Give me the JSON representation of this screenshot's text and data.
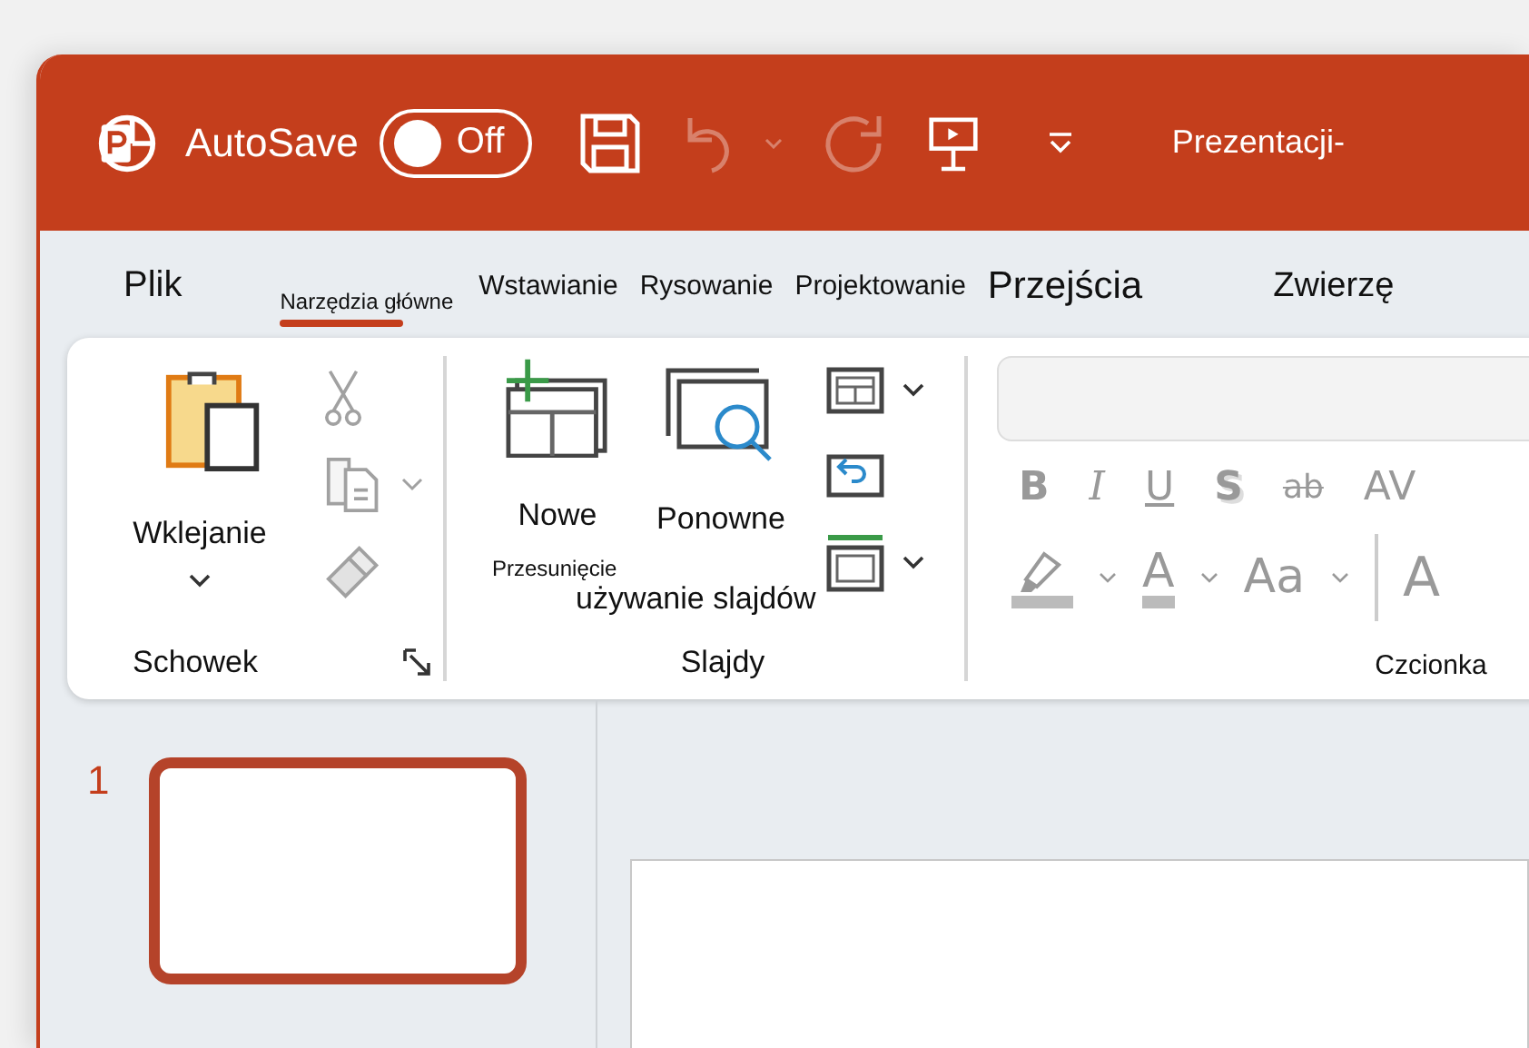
{
  "title_bar": {
    "autosave_label": "AutoSave",
    "autosave_on": false,
    "autosave_state": "Off",
    "title": "Prezentacji-"
  },
  "quick_access": [
    {
      "kind": "save",
      "disabled": false
    },
    {
      "kind": "undo",
      "disabled": true
    },
    {
      "kind": "redo",
      "disabled": true
    },
    {
      "kind": "present",
      "disabled": false
    },
    {
      "kind": "customize",
      "disabled": false
    }
  ],
  "tabs": [
    {
      "label": "Plik",
      "selected": false
    },
    {
      "label": "Narzędzia główne",
      "selected": true
    },
    {
      "label": "Wstawianie",
      "selected": false
    },
    {
      "label": "Rysowanie",
      "selected": false
    },
    {
      "label": "Projektowanie",
      "selected": false
    },
    {
      "label": "Przejścia",
      "selected": false
    },
    {
      "label": "Zwierzę",
      "selected": false
    }
  ],
  "ribbon": {
    "clipboard": {
      "label": "Schowek",
      "paste_label": "Wklejanie",
      "tools": [
        {
          "kind": "cut",
          "disabled": true
        },
        {
          "kind": "copy",
          "disabled": true
        },
        {
          "kind": "painter",
          "disabled": true
        }
      ]
    },
    "slides": {
      "label": "Slajdy",
      "new_label": "Nowe",
      "reuse_label_1": "Ponowne",
      "reuse_label_2": "używanie slajdów",
      "move_label": "Przesunięcie"
    },
    "font": {
      "label": "Czcionka",
      "styles": [
        {
          "text": "B",
          "kind": "bold",
          "disabled": true
        },
        {
          "text": "I",
          "kind": "italic",
          "disabled": true
        },
        {
          "text": "U",
          "kind": "underline",
          "disabled": true
        },
        {
          "text": "S",
          "kind": "shadow",
          "disabled": true
        },
        {
          "text": "ab",
          "kind": "strike",
          "disabled": true
        },
        {
          "text": "AV",
          "kind": "spacing",
          "disabled": true
        }
      ],
      "row2": [
        {
          "text": "A",
          "kind": "color",
          "disabled": true
        },
        {
          "text": "Aa",
          "kind": "case",
          "disabled": true
        },
        {
          "text": "A",
          "kind": "grow",
          "disabled": true
        }
      ]
    }
  },
  "slides": [
    {
      "number": "1",
      "selected": true
    }
  ]
}
